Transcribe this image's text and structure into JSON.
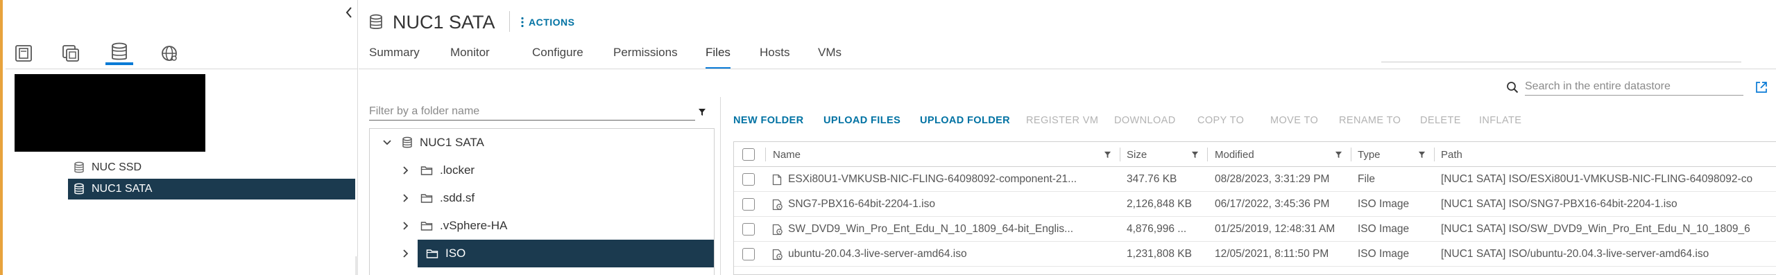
{
  "left_panel": {
    "view_tabs": [
      {
        "name": "hosts-and-clusters-view-icon"
      },
      {
        "name": "vms-and-templates-view-icon"
      },
      {
        "name": "storage-view-icon",
        "active": true
      },
      {
        "name": "networking-view-icon"
      }
    ],
    "tree": [
      {
        "label": "NUC SSD",
        "selected": false
      },
      {
        "label": "NUC1 SATA",
        "selected": true
      }
    ]
  },
  "header": {
    "title": "NUC1 SATA",
    "actions_label": "ACTIONS"
  },
  "nav_tabs": [
    {
      "label": "Summary",
      "active": false
    },
    {
      "label": "Monitor",
      "active": false
    },
    {
      "label": "Configure",
      "active": false
    },
    {
      "label": "Permissions",
      "active": false
    },
    {
      "label": "Files",
      "active": true
    },
    {
      "label": "Hosts",
      "active": false
    },
    {
      "label": "VMs",
      "active": false
    }
  ],
  "search": {
    "placeholder": "Search in the entire datastore"
  },
  "folder_filter": {
    "placeholder": "Filter by a folder name"
  },
  "folder_tree": {
    "root": "NUC1 SATA",
    "folders": [
      {
        "label": ".locker",
        "selected": false
      },
      {
        "label": ".sdd.sf",
        "selected": false
      },
      {
        "label": ".vSphere-HA",
        "selected": false
      },
      {
        "label": "ISO",
        "selected": true
      }
    ]
  },
  "toolbar": {
    "buttons": [
      {
        "label": "NEW FOLDER",
        "enabled": true
      },
      {
        "label": "UPLOAD FILES",
        "enabled": true
      },
      {
        "label": "UPLOAD FOLDER",
        "enabled": true
      },
      {
        "label": "REGISTER VM",
        "enabled": false
      },
      {
        "label": "DOWNLOAD",
        "enabled": false
      },
      {
        "label": "COPY TO",
        "enabled": false
      },
      {
        "label": "MOVE TO",
        "enabled": false
      },
      {
        "label": "RENAME TO",
        "enabled": false
      },
      {
        "label": "DELETE",
        "enabled": false
      },
      {
        "label": "INFLATE",
        "enabled": false
      }
    ]
  },
  "table": {
    "columns": [
      "Name",
      "Size",
      "Modified",
      "Type",
      "Path"
    ],
    "rows": [
      {
        "name": "ESXi80U1-VMKUSB-NIC-FLING-64098092-component-21...",
        "size": "347.76 KB",
        "modified": "08/28/2023, 3:31:29 PM",
        "type": "File",
        "path": "[NUC1 SATA] ISO/ESXi80U1-VMKUSB-NIC-FLING-64098092-co",
        "icon": "file-icon"
      },
      {
        "name": "SNG7-PBX16-64bit-2204-1.iso",
        "size": "2,126,848 KB",
        "modified": "06/17/2022, 3:45:36 PM",
        "type": "ISO Image",
        "path": "[NUC1 SATA] ISO/SNG7-PBX16-64bit-2204-1.iso",
        "icon": "iso-image-icon"
      },
      {
        "name": "SW_DVD9_Win_Pro_Ent_Edu_N_10_1809_64-bit_Englis...",
        "size": "4,876,996 ...",
        "modified": "01/25/2019, 12:48:31 AM",
        "type": "ISO Image",
        "path": "[NUC1 SATA] ISO/SW_DVD9_Win_Pro_Ent_Edu_N_10_1809_6",
        "icon": "iso-image-icon"
      },
      {
        "name": "ubuntu-20.04.3-live-server-amd64.iso",
        "size": "1,231,808 KB",
        "modified": "12/05/2021, 8:11:50 PM",
        "type": "ISO Image",
        "path": "[NUC1 SATA] ISO/ubuntu-20.04.3-live-server-amd64.iso",
        "icon": "iso-image-icon"
      }
    ]
  },
  "colors": {
    "accent_left": "#e8a33d",
    "link_blue": "#0072a3",
    "tab_active": "#0a7bd6",
    "selected_bg": "#1b3a4f"
  }
}
